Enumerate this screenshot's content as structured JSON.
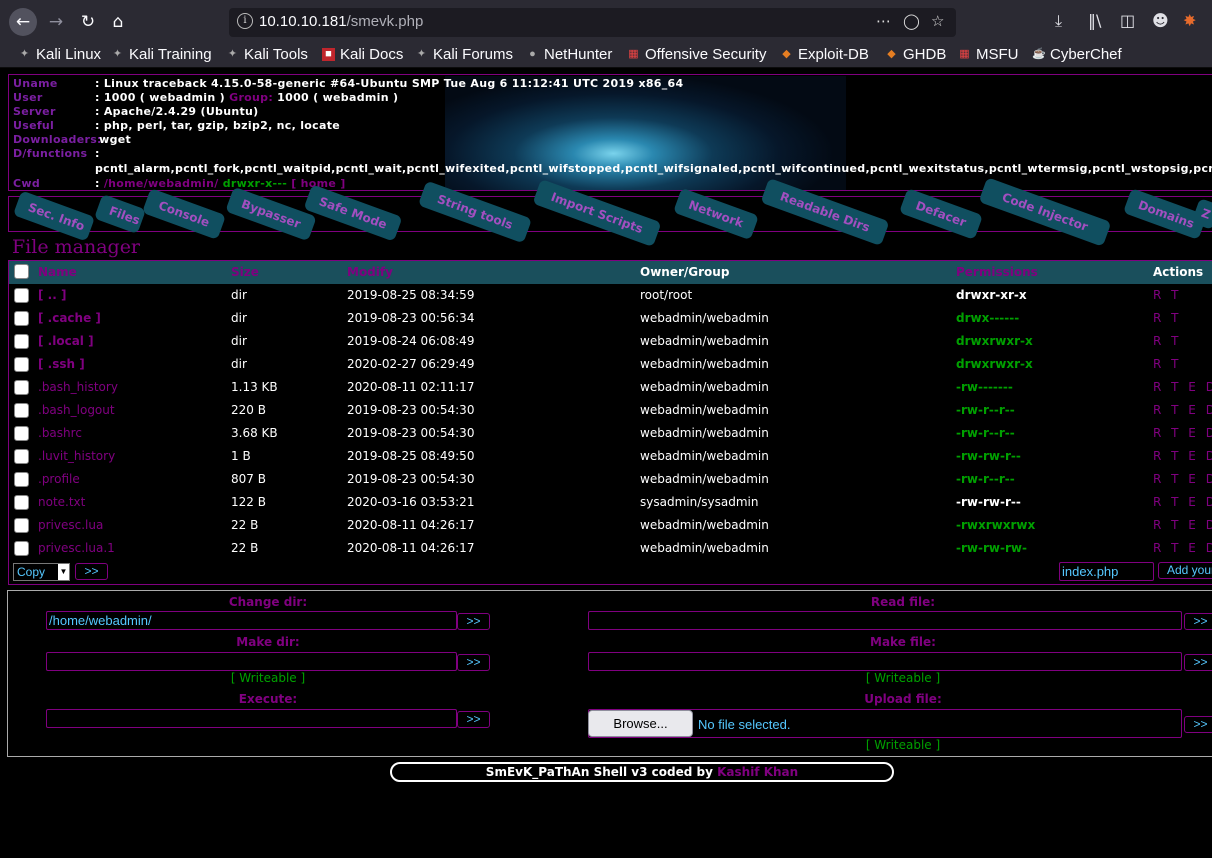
{
  "browser": {
    "url_host": "10.10.10.181",
    "url_path": "/smevk.php",
    "bookmarks": [
      {
        "label": "Kali Linux",
        "icon": "kali-icon"
      },
      {
        "label": "Kali Training",
        "icon": "kali-icon"
      },
      {
        "label": "Kali Tools",
        "icon": "kali-icon"
      },
      {
        "label": "Kali Docs",
        "icon": "kali-docs-icon"
      },
      {
        "label": "Kali Forums",
        "icon": "kali-icon"
      },
      {
        "label": "NetHunter",
        "icon": "nethunter-icon"
      },
      {
        "label": "Offensive Security",
        "icon": "offsec-icon"
      },
      {
        "label": "Exploit-DB",
        "icon": "exploitdb-icon"
      },
      {
        "label": "GHDB",
        "icon": "exploitdb-icon"
      },
      {
        "label": "MSFU",
        "icon": "offsec-icon"
      },
      {
        "label": "CyberChef",
        "icon": "cyberchef-icon"
      }
    ]
  },
  "info": {
    "uname_label": "Uname",
    "uname": "Linux traceback 4.15.0-58-generic #64-Ubuntu SMP Tue Aug 6 11:12:41 UTC 2019 x86_64",
    "user_label": "User",
    "user": "1000 ( webadmin )",
    "group_label": "Group:",
    "group": "1000 ( webadmin )",
    "server_label": "Server",
    "server": "Apache/2.4.29 (Ubuntu)",
    "useful_label": "Useful",
    "useful": "php, perl, tar, gzip, bzip2, nc, locate",
    "downloaders_label": "Downloaders:",
    "downloaders": "wget",
    "dfunctions_label": "D/functions",
    "dfunctions": "pcntl_alarm,pcntl_fork,pcntl_waitpid,pcntl_wait,pcntl_wifexited,pcntl_wifstopped,pcntl_wifsignaled,pcntl_wifcontinued,pcntl_wexitstatus,pcntl_wtermsig,pcntl_wstopsig,pcntl_signal",
    "cwd_label": "Cwd",
    "cwd_path": "/home/webadmin/",
    "cwd_perms": "drwxr-x---",
    "cwd_home": "[ home ]"
  },
  "tabs": [
    "Sec. Info",
    "Files",
    "Console",
    "Bypasser",
    "Safe Mode",
    "String tools",
    "Import Scripts",
    "Network",
    "Readable Dirs",
    "Defacer",
    "Code Injector",
    "Domains",
    "Z"
  ],
  "file_manager": {
    "title": "File manager",
    "headers": {
      "name": "Name",
      "size": "Size",
      "modify": "Modify",
      "owner": "Owner/Group",
      "perms": "Permissions",
      "actions": "Actions"
    },
    "rows": [
      {
        "name": "[ .. ]",
        "size": "dir",
        "modify": "2019-08-25 08:34:59",
        "owner": "root/root",
        "perms": "drwxr-xr-x",
        "perm_style": "w",
        "actions": "R T",
        "is_dir": true
      },
      {
        "name": "[ .cache ]",
        "size": "dir",
        "modify": "2019-08-23 00:56:34",
        "owner": "webadmin/webadmin",
        "perms": "drwx------",
        "perm_style": "g",
        "actions": "R T",
        "is_dir": true
      },
      {
        "name": "[ .local ]",
        "size": "dir",
        "modify": "2019-08-24 06:08:49",
        "owner": "webadmin/webadmin",
        "perms": "drwxrwxr-x",
        "perm_style": "g",
        "actions": "R T",
        "is_dir": true
      },
      {
        "name": "[ .ssh ]",
        "size": "dir",
        "modify": "2020-02-27 06:29:49",
        "owner": "webadmin/webadmin",
        "perms": "drwxrwxr-x",
        "perm_style": "g",
        "actions": "R T",
        "is_dir": true
      },
      {
        "name": ".bash_history",
        "size": "1.13 KB",
        "modify": "2020-08-11 02:11:17",
        "owner": "webadmin/webadmin",
        "perms": "-rw-------",
        "perm_style": "g",
        "actions": "R T E D",
        "is_dir": false
      },
      {
        "name": ".bash_logout",
        "size": "220 B",
        "modify": "2019-08-23 00:54:30",
        "owner": "webadmin/webadmin",
        "perms": "-rw-r--r--",
        "perm_style": "g",
        "actions": "R T E D",
        "is_dir": false
      },
      {
        "name": ".bashrc",
        "size": "3.68 KB",
        "modify": "2019-08-23 00:54:30",
        "owner": "webadmin/webadmin",
        "perms": "-rw-r--r--",
        "perm_style": "g",
        "actions": "R T E D",
        "is_dir": false
      },
      {
        "name": ".luvit_history",
        "size": "1 B",
        "modify": "2019-08-25 08:49:50",
        "owner": "webadmin/webadmin",
        "perms": "-rw-rw-r--",
        "perm_style": "g",
        "actions": "R T E D",
        "is_dir": false
      },
      {
        "name": ".profile",
        "size": "807 B",
        "modify": "2019-08-23 00:54:30",
        "owner": "webadmin/webadmin",
        "perms": "-rw-r--r--",
        "perm_style": "g",
        "actions": "R T E D",
        "is_dir": false
      },
      {
        "name": "note.txt",
        "size": "122 B",
        "modify": "2020-03-16 03:53:21",
        "owner": "sysadmin/sysadmin",
        "perms": "-rw-rw-r--",
        "perm_style": "w",
        "actions": "R T E D",
        "is_dir": false
      },
      {
        "name": "privesc.lua",
        "size": "22 B",
        "modify": "2020-08-11 04:26:17",
        "owner": "webadmin/webadmin",
        "perms": "-rwxrwxrwx",
        "perm_style": "g",
        "actions": "R T E D",
        "is_dir": false
      },
      {
        "name": "privesc.lua.1",
        "size": "22 B",
        "modify": "2020-08-11 04:26:17",
        "owner": "webadmin/webadmin",
        "perms": "-rw-rw-rw-",
        "perm_style": "g",
        "actions": "R T E D",
        "is_dir": false
      }
    ],
    "copy_select": "Copy",
    "go_label": ">>",
    "new_file_value": "index.php",
    "add_button": "Add your"
  },
  "forms": {
    "change_dir_label": "Change dir:",
    "change_dir_value": "/home/webadmin/",
    "make_dir_label": "Make dir:",
    "writeable": "[ Writeable ]",
    "execute_label": "Execute:",
    "read_file_label": "Read file:",
    "make_file_label": "Make file:",
    "upload_label": "Upload file:",
    "browse_label": "Browse...",
    "no_file": "No file selected.",
    "go": ">>"
  },
  "footer": {
    "text": "SmEvK_PaThAn Shell v3 coded by",
    "author": "Kashif Khan"
  }
}
